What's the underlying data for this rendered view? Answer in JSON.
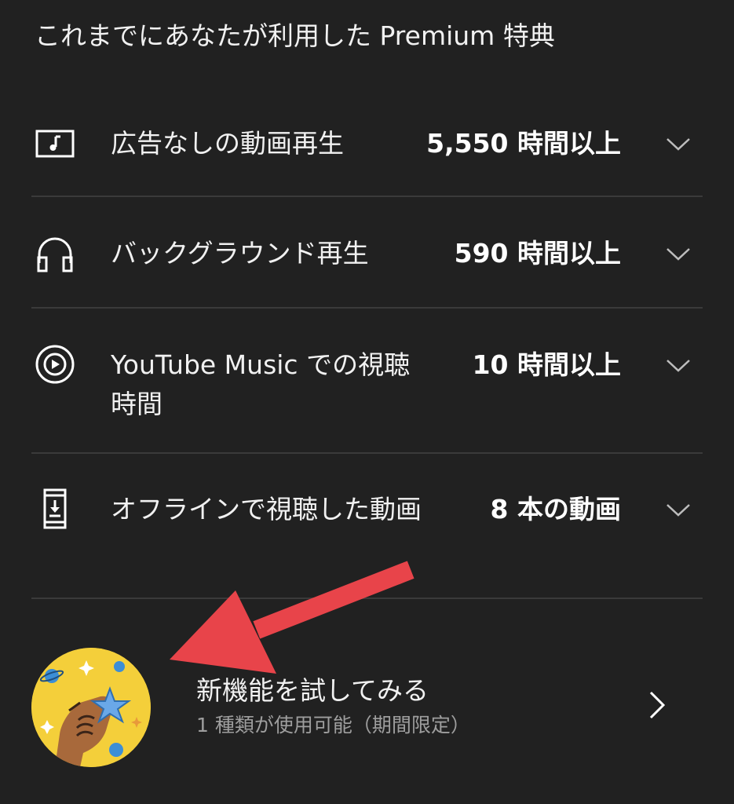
{
  "header": {
    "title": "これまでにあなたが利用した Premium 特典"
  },
  "benefits": [
    {
      "icon": "music-video-icon",
      "label": "広告なしの動画再生",
      "value": "5,550 時間以上"
    },
    {
      "icon": "headphones-icon",
      "label": "バックグラウンド再生",
      "value": "590 時間以上"
    },
    {
      "icon": "youtube-music-icon",
      "label": "YouTube Music での視聴時間",
      "value": "10 時間以上"
    },
    {
      "icon": "phone-download-icon",
      "label": "オフラインで視聴した動画",
      "value": "8 本の動画"
    }
  ],
  "promo": {
    "title": "新機能を試してみる",
    "subtitle": "1 種類が使用可能（期間限定）"
  },
  "colors": {
    "background": "#212121",
    "divider": "#3a3a3a",
    "annotation_arrow": "#e8444a",
    "badge": "#f4cf3a"
  }
}
